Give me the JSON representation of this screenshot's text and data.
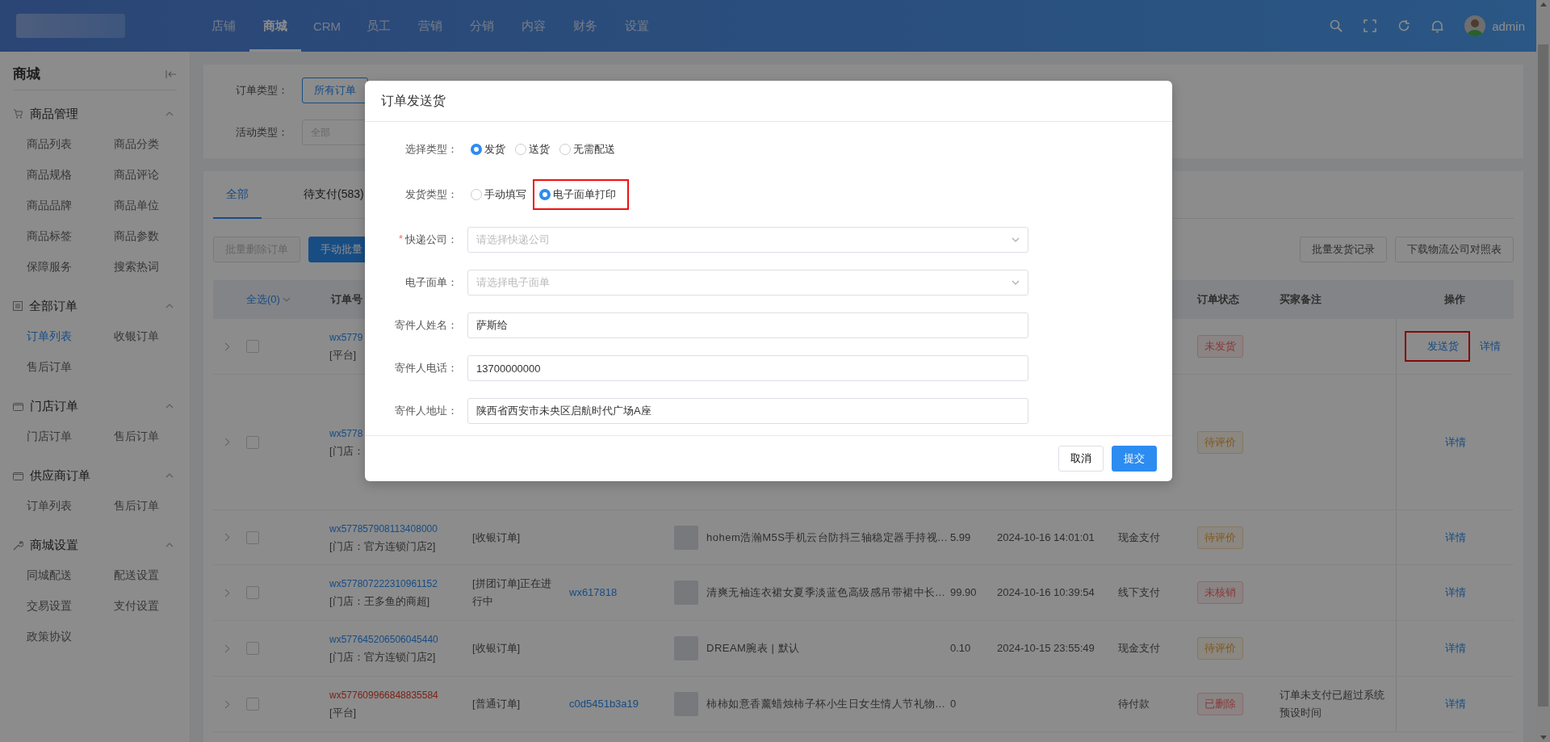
{
  "header": {
    "nav": [
      {
        "label": "店铺",
        "selected": false
      },
      {
        "label": "商城",
        "selected": true
      },
      {
        "label": "CRM",
        "selected": false
      },
      {
        "label": "员工",
        "selected": false
      },
      {
        "label": "营销",
        "selected": false
      },
      {
        "label": "分销",
        "selected": false
      },
      {
        "label": "内容",
        "selected": false
      },
      {
        "label": "财务",
        "selected": false
      },
      {
        "label": "设置",
        "selected": false
      }
    ],
    "user": "admin"
  },
  "sidebar": {
    "title": "商城",
    "groups": [
      {
        "title": "商品管理",
        "expanded": true,
        "items": [
          {
            "label": "商品列表",
            "selected": false
          },
          {
            "label": "商品分类",
            "selected": false
          },
          {
            "label": "商品规格",
            "selected": false
          },
          {
            "label": "商品评论",
            "selected": false
          },
          {
            "label": "商品品牌",
            "selected": false
          },
          {
            "label": "商品单位",
            "selected": false
          },
          {
            "label": "商品标签",
            "selected": false
          },
          {
            "label": "商品参数",
            "selected": false
          },
          {
            "label": "保障服务",
            "selected": false
          },
          {
            "label": "搜索热词",
            "selected": false
          }
        ]
      },
      {
        "title": "全部订单",
        "expanded": true,
        "items": [
          {
            "label": "订单列表",
            "selected": true
          },
          {
            "label": "收银订单",
            "selected": false
          },
          {
            "label": "售后订单",
            "selected": false
          }
        ]
      },
      {
        "title": "门店订单",
        "expanded": true,
        "items": [
          {
            "label": "门店订单",
            "selected": false
          },
          {
            "label": "售后订单",
            "selected": false
          }
        ]
      },
      {
        "title": "供应商订单",
        "expanded": true,
        "items": [
          {
            "label": "订单列表",
            "selected": false
          },
          {
            "label": "售后订单",
            "selected": false
          }
        ]
      },
      {
        "title": "商城设置",
        "expanded": true,
        "items": [
          {
            "label": "同城配送",
            "selected": false
          },
          {
            "label": "配送设置",
            "selected": false
          },
          {
            "label": "交易设置",
            "selected": false
          },
          {
            "label": "支付设置",
            "selected": false
          },
          {
            "label": "政策协议",
            "selected": false
          }
        ]
      }
    ]
  },
  "filters": [
    {
      "label": "订单类型：",
      "kind": "buttons",
      "options": [
        {
          "label": "所有订单",
          "selected": true
        }
      ]
    },
    {
      "label": "活动类型：",
      "kind": "select",
      "placeholder": "全部"
    }
  ],
  "tabs": [
    {
      "label": "全部",
      "selected": true
    },
    {
      "label": "待支付(583)",
      "selected": false
    }
  ],
  "toolbar": {
    "left": [
      {
        "label": "批量删除订单",
        "kind": "default",
        "disabled": true
      },
      {
        "label": "手动批量",
        "kind": "primary",
        "disabled": false
      }
    ],
    "right": [
      "批量发货记录",
      "下载物流公司对照表"
    ]
  },
  "table": {
    "select_all": "全选(0)",
    "columns": {
      "order_no": "订单号",
      "status": "订单状态",
      "remark": "买家备注",
      "actions": "操作"
    },
    "rows": [
      {
        "order_no": "wx5779",
        "deleted": false,
        "source": "[平台]",
        "checked": false,
        "status": {
          "label": "未发货",
          "kind": "danger"
        },
        "actions": [
          {
            "label": "发送货",
            "highlighted": true
          },
          {
            "label": "详情",
            "highlighted": false
          }
        ]
      },
      {
        "order_no": "wx5778",
        "deleted": false,
        "source": "[门店：",
        "checked": false,
        "status": {
          "label": "待评价",
          "kind": "warning"
        },
        "actions": [
          {
            "label": "详情",
            "highlighted": false
          }
        ]
      },
      {
        "order_no": "wx577857908113408000",
        "deleted": false,
        "source": "[门店：官方连锁门店2]",
        "checked": false,
        "type": "[收银订单]",
        "product": "hohem浩瀚M5S手机云台防抖三轴稳定器手持视...",
        "price": "5.99",
        "time": "2024-10-16 14:01:01",
        "payment": "现金支付",
        "status": {
          "label": "待评价",
          "kind": "warning"
        },
        "actions": [
          {
            "label": "详情",
            "highlighted": false
          }
        ]
      },
      {
        "order_no": "wx577807222310961152",
        "deleted": false,
        "source": "[门店：王多鱼的商超]",
        "checked": false,
        "type": "[拼团订单]正在进行中",
        "buyer": "wx617818",
        "product": "清爽无袖连衣裙女夏季淡蓝色高级感吊带裙中长...",
        "price": "99.90",
        "time": "2024-10-16 10:39:54",
        "payment": "线下支付",
        "status": {
          "label": "未核销",
          "kind": "danger"
        },
        "actions": [
          {
            "label": "详情",
            "highlighted": false
          }
        ]
      },
      {
        "order_no": "wx577645206506045440",
        "deleted": false,
        "source": "[门店：官方连锁门店2]",
        "checked": false,
        "type": "[收银订单]",
        "product": "DREAM腕表 | 默认",
        "price": "0.10",
        "time": "2024-10-15 23:55:49",
        "payment": "现金支付",
        "status": {
          "label": "待评价",
          "kind": "warning"
        },
        "actions": [
          {
            "label": "详情",
            "highlighted": false
          }
        ]
      },
      {
        "order_no": "wx577609966848835584",
        "deleted": true,
        "source": "[平台]",
        "checked": false,
        "type": "[普通订单]",
        "buyer": "c0d5451b3a19",
        "product": "柿柿如意香薰蜡烛柿子杯小生日女生情人节礼物...",
        "price": "0",
        "payment": "待付款",
        "status": {
          "label": "已删除",
          "kind": "danger"
        },
        "remark": "订单未支付已超过系统预设时间",
        "actions": [
          {
            "label": "详情",
            "highlighted": false
          }
        ]
      }
    ]
  },
  "dialog": {
    "title": "订单发送货",
    "rows": [
      {
        "kind": "radio",
        "label": "选择类型：",
        "options": [
          {
            "label": "发货",
            "selected": true,
            "highlighted": false
          },
          {
            "label": "送货",
            "selected": false,
            "highlighted": false
          },
          {
            "label": "无需配送",
            "selected": false,
            "highlighted": false
          }
        ]
      },
      {
        "kind": "radio",
        "label": "发货类型：",
        "options": [
          {
            "label": "手动填写",
            "selected": false,
            "highlighted": false
          },
          {
            "label": "电子面单打印",
            "selected": true,
            "highlighted": true
          }
        ]
      },
      {
        "kind": "select",
        "marker": "*",
        "label": "快递公司：",
        "placeholder": "请选择快递公司"
      },
      {
        "kind": "select",
        "label": "电子面单：",
        "placeholder": "请选择电子面单"
      },
      {
        "kind": "input",
        "label": "寄件人姓名：",
        "value": "萨斯给"
      },
      {
        "kind": "input",
        "label": "寄件人电话：",
        "value": "13700000000"
      },
      {
        "kind": "input",
        "label": "寄件人地址：",
        "value": "陕西省西安市未央区启航时代广场A座"
      }
    ],
    "buttons": [
      {
        "label": "取消",
        "kind": "default"
      },
      {
        "label": "提交",
        "kind": "primary"
      }
    ]
  }
}
